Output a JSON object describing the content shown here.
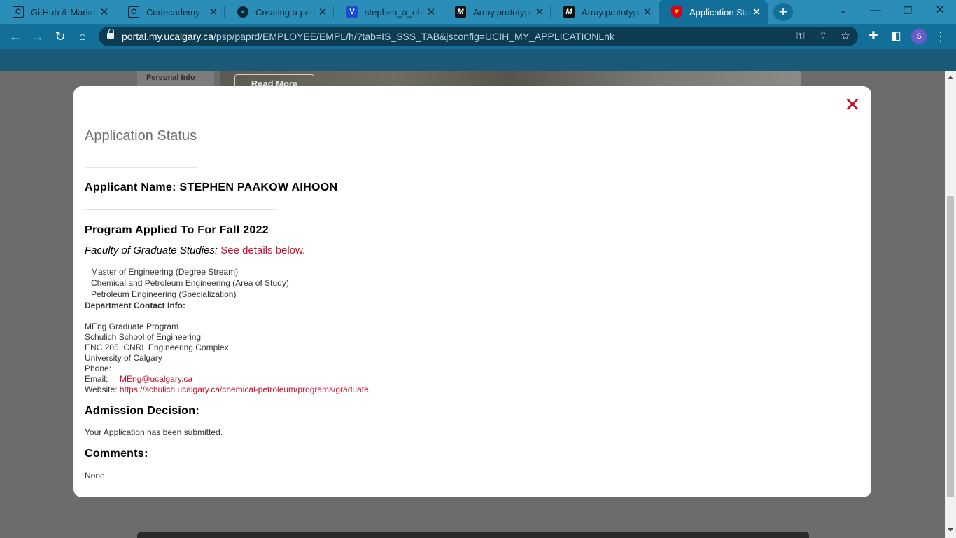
{
  "browser": {
    "tabs": [
      {
        "title": "GitHub & Markdown",
        "favicon": "codecademy-icon"
      },
      {
        "title": "Codecademy",
        "favicon": "codecademy-icon"
      },
      {
        "title": "Creating a personal",
        "favicon": "github-icon"
      },
      {
        "title": "stephen_a_obj | C",
        "favicon": "vertical-bar-icon"
      },
      {
        "title": "Array.prototype.m",
        "favicon": "mdn-icon"
      },
      {
        "title": "Array.prototype.s",
        "favicon": "mdn-icon"
      },
      {
        "title": "Application Status",
        "favicon": "ucalgary-shield-icon",
        "active": true
      }
    ],
    "url_host": "portal.my.ucalgary.ca",
    "url_path": "/psp/paprd/EMPLOYEE/EMPL/h/?tab=IS_SSS_TAB&jsconfig=UCIH_MY_APPLICATIONLnk",
    "profile_initial": "S"
  },
  "background_page": {
    "sidebar_label": "Personal Info",
    "read_more_label": "Read More"
  },
  "modal": {
    "title": "Application Status",
    "close_glyph": "✕",
    "applicant_label": "Applicant Name:",
    "applicant_name": "STEPHEN PAAKOW AIHOON",
    "program_heading": "Program Applied To For Fall 2022",
    "faculty_label": "Faculty of Graduate Studies:",
    "faculty_link": "See details below.",
    "program_lines": [
      "Master of Engineering (Degree Stream)",
      "Chemical and Petroleum Engineering (Area of Study)",
      "Petroleum Engineering (Specialization)"
    ],
    "contact_heading": "Department Contact Info:",
    "contact_lines": [
      "MEng Graduate Program",
      "Schulich School of Engineering",
      "ENC 205, CNRL Engineering Complex",
      "University of Calgary"
    ],
    "phone_label": "Phone:",
    "email_label": "Email:",
    "email": "MEng@ucalgary.ca",
    "website_label": "Website:",
    "website": "https://schulich.ucalgary.ca/chemical-petroleum/programs/graduate",
    "decision_heading": "Admission Decision:",
    "decision_text": "Your Application has been submitted.",
    "comments_heading": "Comments:",
    "comments_text": "None"
  },
  "colors": {
    "tabstrip": "#2a8eb8",
    "toolbar": "#126f99",
    "accent_red": "#c8102e",
    "overlay": "#6c6c6c"
  }
}
